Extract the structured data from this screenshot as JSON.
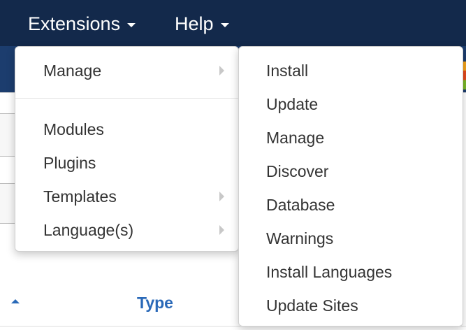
{
  "navbar": {
    "items": [
      {
        "label": "Extensions",
        "icon": "caret-down-icon"
      },
      {
        "label": "Help",
        "icon": "caret-down-icon"
      }
    ]
  },
  "extensions_menu": {
    "items": [
      {
        "label": "Manage",
        "has_submenu": true
      },
      {
        "label": "Modules",
        "has_submenu": false
      },
      {
        "label": "Plugins",
        "has_submenu": false
      },
      {
        "label": "Templates",
        "has_submenu": true
      },
      {
        "label": "Language(s)",
        "has_submenu": true
      }
    ]
  },
  "manage_submenu": {
    "items": [
      {
        "label": "Install"
      },
      {
        "label": "Update"
      },
      {
        "label": "Manage"
      },
      {
        "label": "Discover"
      },
      {
        "label": "Database"
      },
      {
        "label": "Warnings"
      },
      {
        "label": "Install Languages"
      },
      {
        "label": "Update Sites"
      }
    ]
  },
  "background": {
    "column_type_label": "Type"
  },
  "colors": {
    "navbar_bg": "#13294b",
    "header_bg": "#1c3d6e",
    "link_blue": "#2a69b8",
    "menu_text": "#333333"
  }
}
